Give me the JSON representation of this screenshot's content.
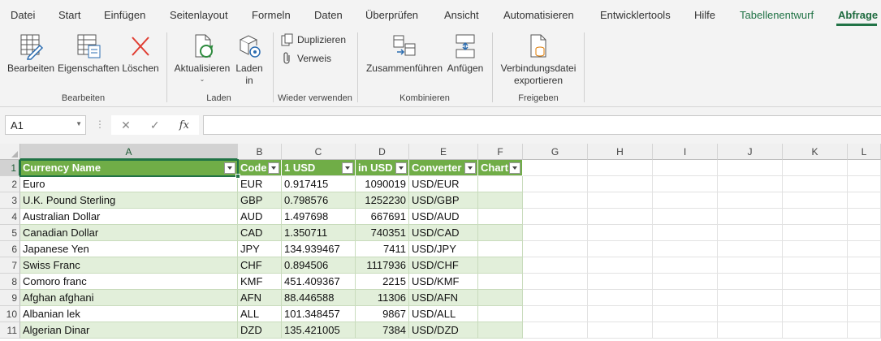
{
  "tabs": [
    "Datei",
    "Start",
    "Einfügen",
    "Seitenlayout",
    "Formeln",
    "Daten",
    "Überprüfen",
    "Ansicht",
    "Automatisieren",
    "Entwicklertools",
    "Hilfe",
    "Tabellenentwurf",
    "Abfrage"
  ],
  "ribbon": {
    "edit": "Bearbeiten",
    "properties": "Eigenschaften",
    "delete": "Löschen",
    "group_edit": "Bearbeiten",
    "refresh": "Aktualisieren",
    "load_line1": "Laden",
    "load_line2": "in",
    "group_load": "Laden",
    "duplicate": "Duplizieren",
    "reference": "Verweis",
    "group_reuse": "Wieder verwenden",
    "merge": "Zusammenführen",
    "append": "Anfügen",
    "group_combine": "Kombinieren",
    "export_line1": "Verbindungsdatei",
    "export_line2": "exportieren",
    "group_share": "Freigeben"
  },
  "formula_bar": {
    "name_box": "A1",
    "formula": ""
  },
  "columns": [
    "A",
    "B",
    "C",
    "D",
    "E",
    "F",
    "G",
    "H",
    "I",
    "J",
    "K",
    "L"
  ],
  "rows": [
    "1",
    "2",
    "3",
    "4",
    "5",
    "6",
    "7",
    "8",
    "9",
    "10",
    "11"
  ],
  "table": {
    "headers": [
      "Currency Name",
      "Code",
      "1 USD",
      "in USD",
      "Converter",
      "Chart"
    ],
    "rows": [
      [
        "Euro",
        "EUR",
        "0.917415",
        "1090019",
        "USD/EUR",
        ""
      ],
      [
        "U.K. Pound Sterling",
        "GBP",
        "0.798576",
        "1252230",
        "USD/GBP",
        ""
      ],
      [
        "Australian Dollar",
        "AUD",
        "1.497698",
        "667691",
        "USD/AUD",
        ""
      ],
      [
        "Canadian Dollar",
        "CAD",
        "1.350711",
        "740351",
        "USD/CAD",
        ""
      ],
      [
        "Japanese Yen",
        "JPY",
        "134.939467",
        "7411",
        "USD/JPY",
        ""
      ],
      [
        "Swiss Franc",
        "CHF",
        "0.894506",
        "1117936",
        "USD/CHF",
        ""
      ],
      [
        "Comoro franc",
        "KMF",
        "451.409367",
        "2215",
        "USD/KMF",
        ""
      ],
      [
        "Afghan afghani",
        "AFN",
        "88.446588",
        "11306",
        "USD/AFN",
        ""
      ],
      [
        "Albanian lek",
        "ALL",
        "101.348457",
        "9867",
        "USD/ALL",
        ""
      ],
      [
        "Algerian Dinar",
        "DZD",
        "135.421005",
        "7384",
        "USD/DZD",
        ""
      ]
    ]
  },
  "colors": {
    "accent": "#217346",
    "table_header": "#70ad47",
    "table_band": "#e2efda"
  }
}
